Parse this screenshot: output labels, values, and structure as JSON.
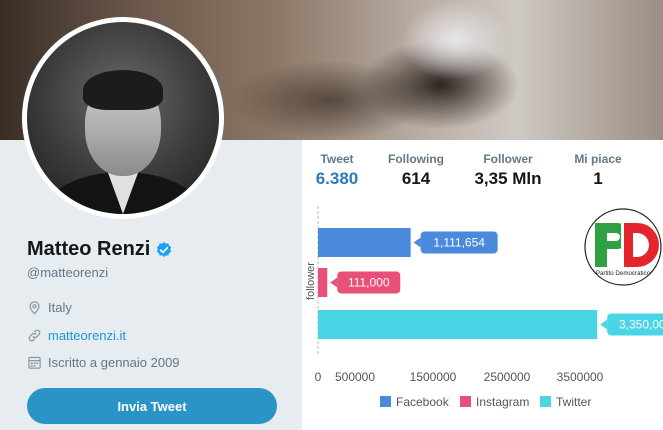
{
  "profile": {
    "name": "Matteo Renzi",
    "handle": "@matteorenzi",
    "location": "Italy",
    "website": "matteorenzi.it",
    "joined": "Iscritto a gennaio 2009",
    "tweet_button": "Invia Tweet"
  },
  "stats": [
    {
      "label": "Tweet",
      "value": "6.380"
    },
    {
      "label": "Following",
      "value": "614"
    },
    {
      "label": "Follower",
      "value": "3,35 Mln"
    },
    {
      "label": "Mi piace",
      "value": "1"
    }
  ],
  "logo": {
    "text": "Partito Democratico"
  },
  "icons": {
    "verified": "verified-badge-icon",
    "location": "location-pin-icon",
    "link": "link-icon",
    "calendar": "calendar-icon"
  },
  "colors": {
    "facebook": "#4a89dc",
    "instagram": "#e8507a",
    "twitter": "#48d6e6",
    "button": "#2b94c7",
    "link": "#1b95e0"
  },
  "chart_data": {
    "type": "bar",
    "orientation": "horizontal",
    "categories": [
      "Facebook",
      "Instagram",
      "Twitter"
    ],
    "values": [
      1111654,
      111000,
      3350000
    ],
    "data_labels": [
      "1,111,654",
      "111,000",
      "3,350,000"
    ],
    "ylabel": "follower",
    "xlabel": "",
    "x_ticks": [
      "0",
      "500000",
      "1500000",
      "2500000",
      "3500000"
    ],
    "xlim": [
      0,
      4000000
    ],
    "legend": [
      "Facebook",
      "Instagram",
      "Twitter"
    ],
    "legend_position": "bottom",
    "grid": false
  }
}
